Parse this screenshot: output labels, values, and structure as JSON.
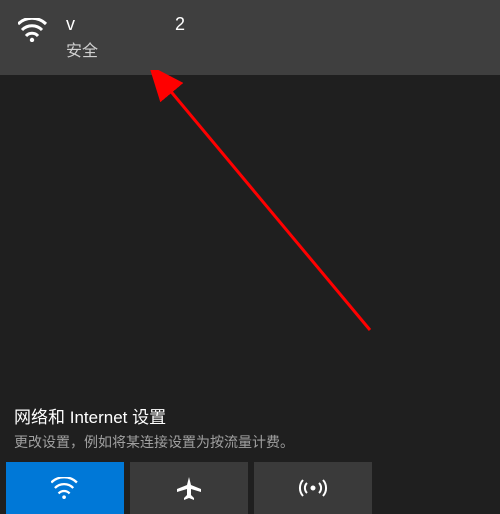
{
  "wifi": {
    "name_prefix": "v",
    "name_suffix": "2",
    "status": "安全"
  },
  "settings": {
    "title": "网络和 Internet 设置",
    "description": "更改设置，例如将某连接设置为按流量计费。"
  },
  "quick_actions": {
    "wifi_state": "active",
    "airplane_state": "inactive",
    "hotspot_state": "inactive"
  },
  "annotation": {
    "color": "#ff0000"
  }
}
